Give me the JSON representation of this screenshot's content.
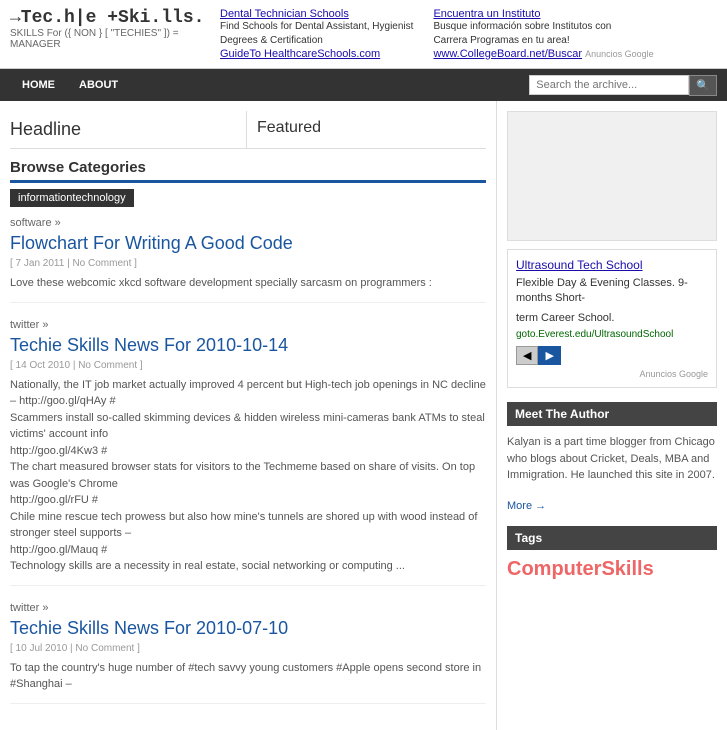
{
  "header": {
    "logo_title": "→Tec.h|e +Ski.lls.",
    "logo_subtitle": "SKILLS For ({ NON } [ \"TECHIES\" ]) = MANAGER",
    "ad1": {
      "link_text": "Dental Technician Schools",
      "line1": "Find Schools for Dental Assistant, Hygienist",
      "line2": "Degrees & Certification",
      "link2": "GuideTo HealthcareSchools.com"
    },
    "ad2": {
      "link_text": "Encuentra un Instituto",
      "line1": "Busque información sobre Institutos con",
      "line2": "Carrera Programas en tu area!",
      "link2": "www.CollegeBoard.net/Buscar",
      "label": "Anuncios Google"
    }
  },
  "nav": {
    "items": [
      "HOME",
      "ABOUT"
    ],
    "search_placeholder": "Search the archive..."
  },
  "headline": {
    "label": "Headline"
  },
  "featured": {
    "label": "Featured"
  },
  "browse": {
    "label": "Browse Categories",
    "category": "informationtechnology"
  },
  "posts": [
    {
      "category": "software »",
      "title": "Flowchart For Writing A Good Code",
      "meta": "[ 7 Jan 2011 | No Comment ]",
      "excerpt": "Love these webcomic xkcd software development specially sarcasm on programmers :"
    },
    {
      "category": "twitter »",
      "title": "Techie Skills News For 2010-10-14",
      "meta": "[ 14 Oct 2010 | No Comment ]",
      "excerpt": "Nationally, the IT job market actually improved 4 percent but High-tech job openings in NC decline – http://goo.gl/qHAy #\nScammers install so-called skimming devices & hidden wireless mini-cameras bank ATMs to steal victims' account info\nhttp://goo.gl/4Kw3 #\nThe chart measured browser stats for visitors to the Techmeme based on share of visits. On top was Google's Chrome\nhttp://goo.gl/rFU #\nChile mine rescue tech prowess but also how mine's tunnels are shored up with wood instead of stronger steel supports –\nhttp://goo.gl/Mauq #\nTechnology skills are a necessity in real estate, social networking or computing ..."
    },
    {
      "category": "twitter »",
      "title": "Techie Skills News For 2010-07-10",
      "meta": "[ 10 Jul 2010 | No Comment ]",
      "excerpt": "To tap the country's huge number of #tech savvy young customers #Apple opens second store in #Shanghai –"
    }
  ],
  "sidebar": {
    "ad": {
      "title": "Ultrasound Tech School",
      "line1": "Flexible Day & Evening Classes. 9-months Short-",
      "line2": "term Career School.",
      "link": "goto.Everest.edu/UltrasoundSchool",
      "label": "Anuncios Google"
    },
    "author": {
      "heading": "Meet The Author",
      "text": "Kalyan is a part time blogger from Chicago who blogs about Cricket, Deals, MBA and Immigration. He launched this site in 2007.",
      "more_link": "More →"
    },
    "tags": {
      "heading": "Tags",
      "content": "ComputerSkills"
    }
  }
}
